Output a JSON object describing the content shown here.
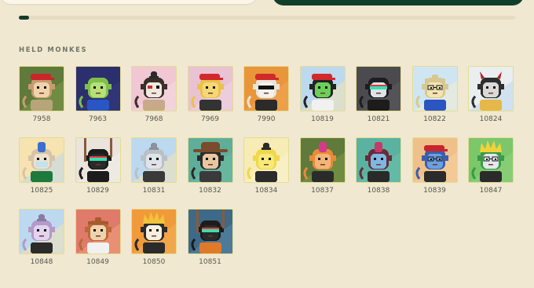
{
  "scroll": {
    "progress": 0.02
  },
  "section": {
    "title": "HELD MONKES"
  },
  "monkes": [
    {
      "id": "7958",
      "bg": "#5f7a3b",
      "bg2": "#7d9a49",
      "fur": "#c79c6e",
      "face": "#efd3ad",
      "hat": "cap",
      "hat_color": "#c8262b",
      "shirt": "#b7a47a",
      "eyes": "normal"
    },
    {
      "id": "7963",
      "bg": "#2c2f6e",
      "bg2": "#343a82",
      "fur": "#7fbf4a",
      "face": "#b6e07a",
      "hat": "none",
      "hat_color": "#000000",
      "shirt": "#2a55c4",
      "eyes": "normal"
    },
    {
      "id": "7968",
      "bg": "#f0c7d2",
      "bg2": "#f6dbe3",
      "fur": "#3a2f2b",
      "face": "#efe9e1",
      "hat": "bun",
      "hat_color": "#2a2a2a",
      "shirt": "#c8a98a",
      "eyes": "paint"
    },
    {
      "id": "7969",
      "bg": "#e9c2d4",
      "bg2": "#f1d6e3",
      "fur": "#e9c24a",
      "face": "#f4d878",
      "hat": "cap",
      "hat_color": "#d22a2a",
      "shirt": "#333333",
      "eyes": "normal"
    },
    {
      "id": "7990",
      "bg": "#e9963b",
      "bg2": "#f0a856",
      "fur": "#e9e4dc",
      "face": "#f4f1ec",
      "hat": "cap",
      "hat_color": "#d22a2a",
      "shirt": "#2b2b2b",
      "eyes": "shades"
    },
    {
      "id": "10819",
      "bg": "#bcd9ef",
      "bg2": "#f6e3b0",
      "fur": "#232323",
      "face": "#6ccf5a",
      "hat": "cap",
      "hat_color": "#d22a2a",
      "shirt": "#f1f1f1",
      "eyes": "normal"
    },
    {
      "id": "10821",
      "bg": "#4b4b4f",
      "bg2": "#5b5b60",
      "fur": "#1e1e22",
      "face": "#dfe3ea",
      "hat": "none",
      "hat_color": "#000000",
      "shirt": "#1c1c1c",
      "eyes": "visor"
    },
    {
      "id": "10822",
      "bg": "#cfe6f2",
      "bg2": "#f4ecd0",
      "fur": "#d8c890",
      "face": "#f1e6b3",
      "hat": "band",
      "hat_color": "#d8c890",
      "shirt": "#2b56c2",
      "eyes": "glasses"
    },
    {
      "id": "10824",
      "bg": "#e9eef0",
      "bg2": "#bcd9ef",
      "fur": "#2e2e2e",
      "face": "#d9d9d9",
      "hat": "horns",
      "hat_color": "#b81f26",
      "shirt": "#e6b84a",
      "eyes": "normal"
    },
    {
      "id": "10825",
      "bg": "#f6e3b0",
      "bg2": "#bcd9ef",
      "fur": "#d6c3a8",
      "face": "#efe2cc",
      "hat": "mohawk",
      "hat_color": "#3b6fd1",
      "shirt": "#1e7a3c",
      "eyes": "mask"
    },
    {
      "id": "10829",
      "bg": "#e9e4dc",
      "bg2": "#f3efe9",
      "fur": "#1c1c1c",
      "face": "#2a2a2a",
      "hat": "rope",
      "hat_color": "#8a5a3a",
      "shirt": "#1c1c1c",
      "eyes": "visor"
    },
    {
      "id": "10831",
      "bg": "#bcd9ef",
      "bg2": "#f6e3b0",
      "fur": "#b9c0c7",
      "face": "#dfe4ea",
      "hat": "bun",
      "hat_color": "#8a929a",
      "shirt": "#3a3a3a",
      "eyes": "normal"
    },
    {
      "id": "10832",
      "bg": "#5fae9a",
      "bg2": "#6fbba6",
      "fur": "#2b2b2b",
      "face": "#e8c7a0",
      "hat": "cowboy",
      "hat_color": "#7a4b2c",
      "shirt": "#3a3a3a",
      "eyes": "normal"
    },
    {
      "id": "10834",
      "bg": "#f7ebb6",
      "bg2": "#fbf3d2",
      "fur": "#f0d84a",
      "face": "#f7e97a",
      "hat": "bun",
      "hat_color": "#2b2b2b",
      "shirt": "#2b2b2b",
      "eyes": "normal"
    },
    {
      "id": "10837",
      "bg": "#5f7a3b",
      "bg2": "#7d9a49",
      "fur": "#e88a3a",
      "face": "#f3b577",
      "hat": "mohawk",
      "hat_color": "#d43a8a",
      "shirt": "#2b2b2b",
      "eyes": "normal"
    },
    {
      "id": "10838",
      "bg": "#59b3a0",
      "bg2": "#6cc0ad",
      "fur": "#6a2a3a",
      "face": "#7fb7e3",
      "hat": "mohawk",
      "hat_color": "#c43a6a",
      "shirt": "#2a2a2a",
      "eyes": "normal"
    },
    {
      "id": "10839",
      "bg": "#f0c08a",
      "bg2": "#f5cf9f",
      "fur": "#3a5fb0",
      "face": "#6aa0e0",
      "hat": "cap",
      "hat_color": "#c8262b",
      "shirt": "#2b2b2b",
      "eyes": "glasses"
    },
    {
      "id": "10847",
      "bg": "#7cc76a",
      "bg2": "#8fd27d",
      "fur": "#3a9a4a",
      "face": "#e3e8ec",
      "hat": "spiky",
      "hat_color": "#f2d23a",
      "shirt": "#2b2b2b",
      "eyes": "glasses"
    },
    {
      "id": "10848",
      "bg": "#bcd9ef",
      "bg2": "#f6e3b0",
      "fur": "#b39ac8",
      "face": "#e3d3ee",
      "hat": "bun",
      "hat_color": "#8a7aa0",
      "shirt": "#2b2b2b",
      "eyes": "normal"
    },
    {
      "id": "10849",
      "bg": "#e07a6a",
      "bg2": "#f0a07a",
      "fur": "#b86a3a",
      "face": "#efd3ad",
      "hat": "band",
      "hat_color": "#a85a2a",
      "shirt": "#f1f1f1",
      "eyes": "normal"
    },
    {
      "id": "10850",
      "bg": "#f09a3a",
      "bg2": "#f4b057",
      "fur": "#2b2b2b",
      "face": "#f7eede",
      "hat": "spiky",
      "hat_color": "#f2c33a",
      "shirt": "#2b2b2b",
      "eyes": "normal"
    },
    {
      "id": "10851",
      "bg": "#3e6a8a",
      "bg2": "#5a86a6",
      "fur": "#1c1c1c",
      "face": "#2a2a2a",
      "hat": "rope",
      "hat_color": "#8a5a3a",
      "shirt": "#e07a2a",
      "eyes": "visor"
    }
  ]
}
